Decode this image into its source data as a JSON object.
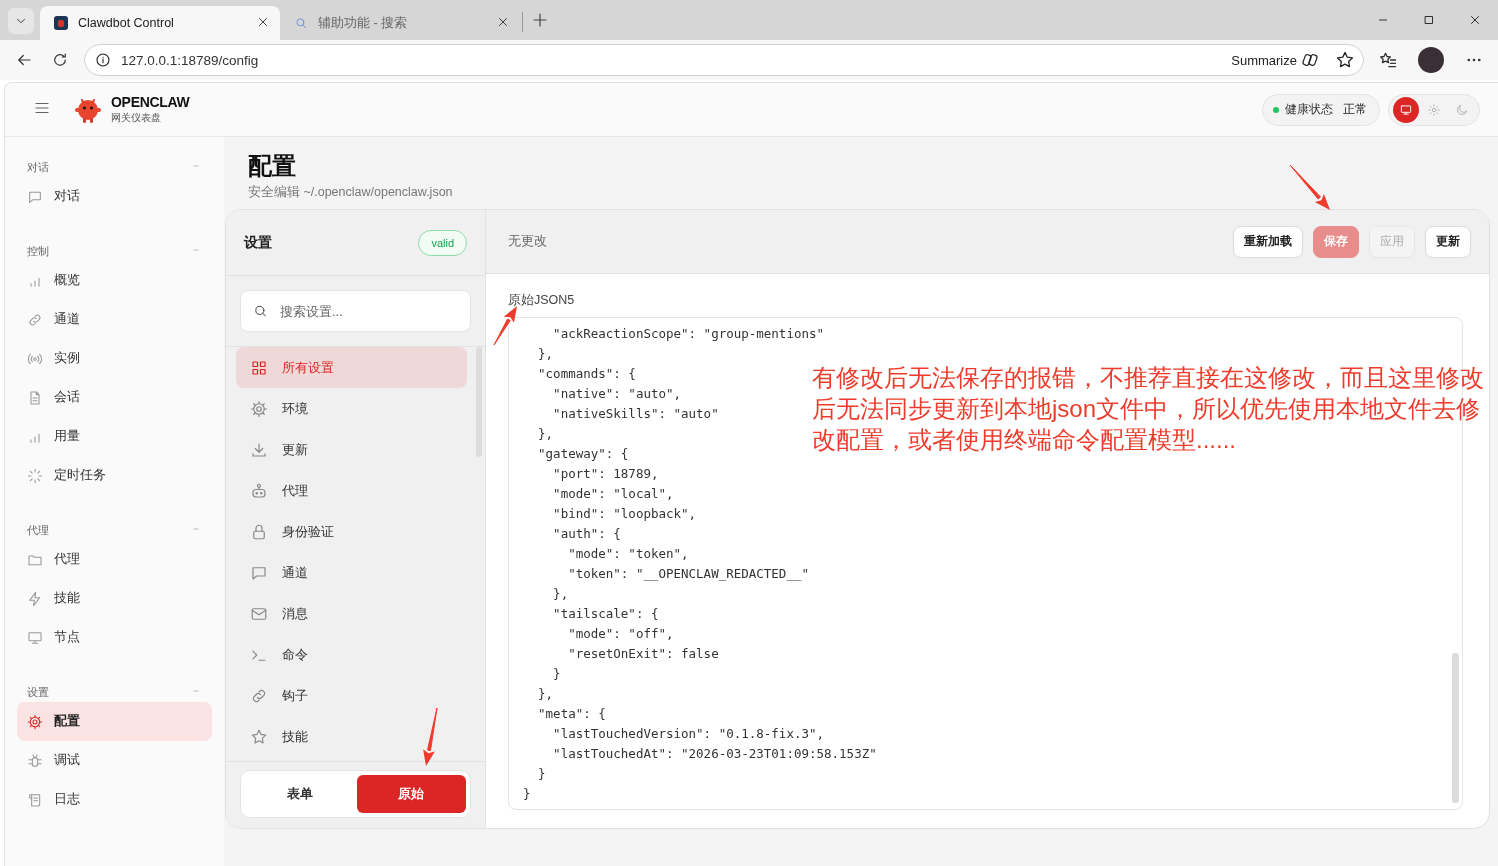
{
  "browser": {
    "tabs": [
      {
        "title": "Clawdbot Control",
        "kind": "app",
        "selected": true
      },
      {
        "title": "辅助功能 - 搜索",
        "kind": "search",
        "selected": false
      }
    ],
    "address": "127.0.0.1:18789/config",
    "summarize": "Summarize"
  },
  "app": {
    "brand": "OPENCLAW",
    "subtitle": "网关仪表盘",
    "health": {
      "label": "健康状态",
      "value": "正常",
      "color": "#22c55e"
    },
    "themes": [
      {
        "kind": "system",
        "selected": true
      },
      {
        "kind": "light",
        "selected": false
      },
      {
        "kind": "dark",
        "selected": false
      }
    ]
  },
  "sidebar": {
    "groups": [
      {
        "label": "对话",
        "expanded": true,
        "items": [
          {
            "label": "对话",
            "kind": "chat",
            "selected": false
          }
        ]
      },
      {
        "label": "控制",
        "expanded": true,
        "items": [
          {
            "label": "概览",
            "kind": "bars",
            "selected": false
          },
          {
            "label": "通道",
            "kind": "link",
            "selected": false
          },
          {
            "label": "实例",
            "kind": "radio",
            "selected": false
          },
          {
            "label": "会话",
            "kind": "doc",
            "selected": false
          },
          {
            "label": "用量",
            "kind": "bars",
            "selected": false
          },
          {
            "label": "定时任务",
            "kind": "spinner",
            "selected": false
          }
        ]
      },
      {
        "label": "代理",
        "expanded": true,
        "items": [
          {
            "label": "代理",
            "kind": "folder",
            "selected": false
          },
          {
            "label": "技能",
            "kind": "bolt",
            "selected": false
          },
          {
            "label": "节点",
            "kind": "monitor",
            "selected": false
          }
        ]
      },
      {
        "label": "设置",
        "expanded": true,
        "items": [
          {
            "label": "配置",
            "kind": "gear",
            "selected": true
          },
          {
            "label": "调试",
            "kind": "bug",
            "selected": false
          },
          {
            "label": "日志",
            "kind": "scroll",
            "selected": false
          }
        ]
      }
    ]
  },
  "page": {
    "title": "配置",
    "subtitle": "安全编辑 ~/.openclaw/openclaw.json"
  },
  "settings": {
    "title": "设置",
    "badge": "valid",
    "search": {
      "placeholder": "搜索设置..."
    },
    "sections": [
      {
        "label": "所有设置",
        "kind": "grid",
        "selected": true
      },
      {
        "label": "环境",
        "kind": "gear",
        "selected": false
      },
      {
        "label": "更新",
        "kind": "download",
        "selected": false
      },
      {
        "label": "代理",
        "kind": "robot",
        "selected": false
      },
      {
        "label": "身份验证",
        "kind": "lock",
        "selected": false
      },
      {
        "label": "通道",
        "kind": "chat",
        "selected": false
      },
      {
        "label": "消息",
        "kind": "mail",
        "selected": false
      },
      {
        "label": "命令",
        "kind": "terminal",
        "selected": false
      },
      {
        "label": "钩子",
        "kind": "link",
        "selected": false
      },
      {
        "label": "技能",
        "kind": "star",
        "selected": false
      }
    ],
    "modes": [
      {
        "label": "表单",
        "selected": false
      },
      {
        "label": "原始",
        "selected": true
      }
    ]
  },
  "editor": {
    "status": "无更改",
    "buttons": [
      {
        "label": "重新加载",
        "kind": "default",
        "disabled": false
      },
      {
        "label": "保存",
        "kind": "primary",
        "disabled": true
      },
      {
        "label": "应用",
        "kind": "default",
        "disabled": true
      },
      {
        "label": "更新",
        "kind": "default",
        "disabled": false
      }
    ],
    "label": "原始JSON5",
    "lines": [
      "    \"ackReactionScope\": \"group-mentions\"",
      "  },",
      "  \"commands\": {",
      "    \"native\": \"auto\",",
      "    \"nativeSkills\": \"auto\"",
      "  },",
      "  \"gateway\": {",
      "    \"port\": 18789,",
      "    \"mode\": \"local\",",
      "    \"bind\": \"loopback\",",
      "    \"auth\": {",
      "      \"mode\": \"token\",",
      "      \"token\": \"__OPENCLAW_REDACTED__\"",
      "    },",
      "    \"tailscale\": {",
      "      \"mode\": \"off\",",
      "      \"resetOnExit\": false",
      "    }",
      "  },",
      "  \"meta\": {",
      "    \"lastTouchedVersion\": \"0.1.8-fix.3\",",
      "    \"lastTouchedAt\": \"2026-03-23T01:09:58.153Z\"",
      "  }",
      "}"
    ]
  },
  "annotation": {
    "text": "有修改后无法保存的报错，不推荐直接在这修改，而且这里修改后无法同步更新到本地json文件中，所以优先使用本地文件去修改配置，或者使用终端命令配置模型......"
  }
}
